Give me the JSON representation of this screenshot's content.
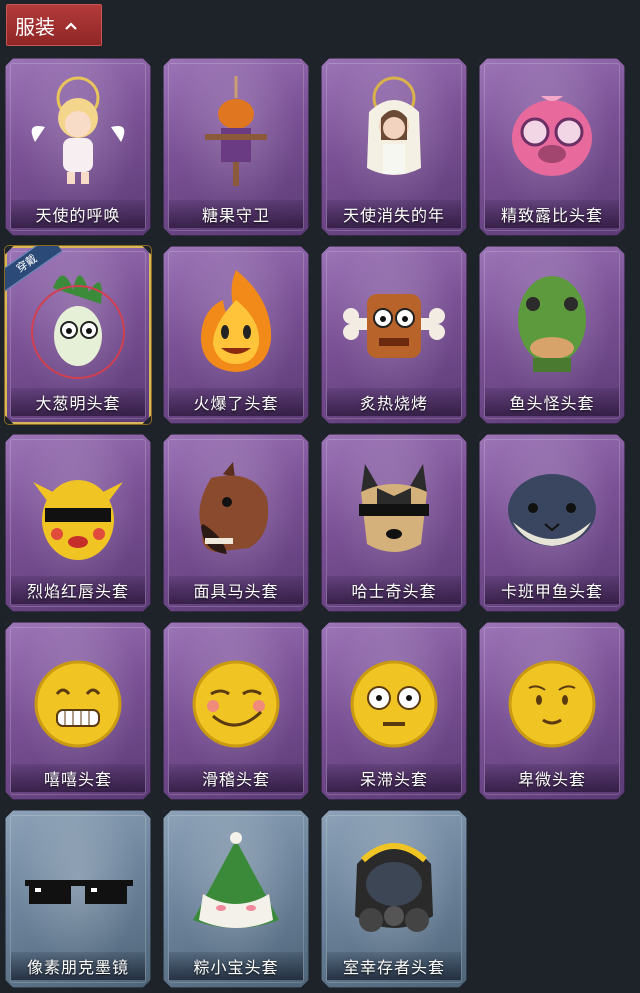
{
  "header": {
    "tab_label": "服装",
    "tab_icon": "chevron-up-icon",
    "accent": "#a52f2f"
  },
  "colors": {
    "background": "#1e2229",
    "card_purple": "#7a5195",
    "card_blue": "#6d849c",
    "equipped_border": "#d8b75b"
  },
  "items": [
    {
      "name": "天使的呼唤",
      "icon": "angel-doll-icon",
      "rarity": "purple"
    },
    {
      "name": "糖果守卫",
      "icon": "pumpkin-scarecrow-icon",
      "rarity": "purple"
    },
    {
      "name": "天使消失的年",
      "icon": "halo-girl-icon",
      "rarity": "purple"
    },
    {
      "name": "精致露比头套",
      "icon": "pink-glasses-head-icon",
      "rarity": "purple"
    },
    {
      "name": "大葱明头套",
      "icon": "scallion-head-icon",
      "rarity": "purple",
      "equipped": true,
      "badge": "穿戴"
    },
    {
      "name": "火爆了头套",
      "icon": "fire-head-icon",
      "rarity": "purple"
    },
    {
      "name": "炙热烧烤",
      "icon": "meat-bone-icon",
      "rarity": "purple"
    },
    {
      "name": "鱼头怪头套",
      "icon": "fish-head-icon",
      "rarity": "purple"
    },
    {
      "name": "烈焰红唇头套",
      "icon": "yellow-mouse-glasses-icon",
      "rarity": "purple"
    },
    {
      "name": "面具马头套",
      "icon": "horse-mask-icon",
      "rarity": "purple"
    },
    {
      "name": "哈士奇头套",
      "icon": "husky-glasses-icon",
      "rarity": "purple"
    },
    {
      "name": "卡班甲鱼头套",
      "icon": "whale-head-icon",
      "rarity": "purple"
    },
    {
      "name": "嘻嘻头套",
      "icon": "grin-emoji-icon",
      "rarity": "purple"
    },
    {
      "name": "滑稽头套",
      "icon": "smirk-emoji-icon",
      "rarity": "purple"
    },
    {
      "name": "呆滞头套",
      "icon": "dazed-emoji-icon",
      "rarity": "purple"
    },
    {
      "name": "卑微头套",
      "icon": "humble-emoji-icon",
      "rarity": "purple"
    },
    {
      "name": "像素朋克墨镜",
      "icon": "pixel-sunglasses-icon",
      "rarity": "blue"
    },
    {
      "name": "粽小宝头套",
      "icon": "zongzi-head-icon",
      "rarity": "blue"
    },
    {
      "name": "室幸存者头套",
      "icon": "gas-mask-helmet-icon",
      "rarity": "blue"
    }
  ]
}
